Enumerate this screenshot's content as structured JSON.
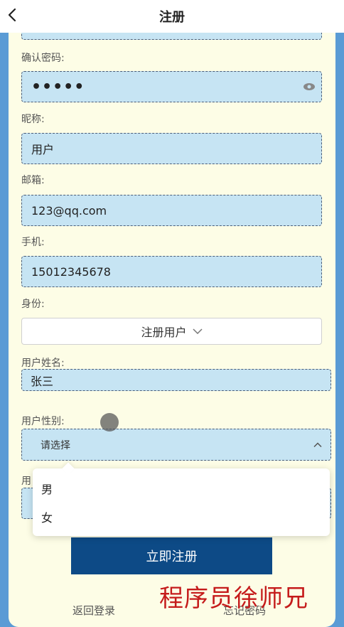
{
  "header": {
    "title": "注册"
  },
  "form": {
    "password_dots_top": "••••",
    "confirm_password": {
      "label": "确认密码:",
      "value": "•••••"
    },
    "nickname": {
      "label": "昵称:",
      "value": "用户"
    },
    "email": {
      "label": "邮箱:",
      "value": "123@qq.com"
    },
    "phone": {
      "label": "手机:",
      "value": "15012345678"
    },
    "identity": {
      "label": "身份:",
      "value": "注册用户"
    },
    "real_name": {
      "label": "用户姓名:",
      "value": "张三"
    },
    "gender": {
      "label": "用户性别:",
      "placeholder": "请选择",
      "options": [
        "男",
        "女"
      ]
    },
    "next_label_partial": "用"
  },
  "actions": {
    "submit_label": "立即注册",
    "back_login_label": "返回登录",
    "forgot_password_label": "忘记密码"
  },
  "watermark": "程序员徐师兄",
  "colors": {
    "page_bg": "#5a9bd5",
    "card_bg": "#fdfde6",
    "field_bg": "#c6e4f3",
    "submit_bg": "#0d4a86",
    "watermark": "#c51b1b"
  }
}
